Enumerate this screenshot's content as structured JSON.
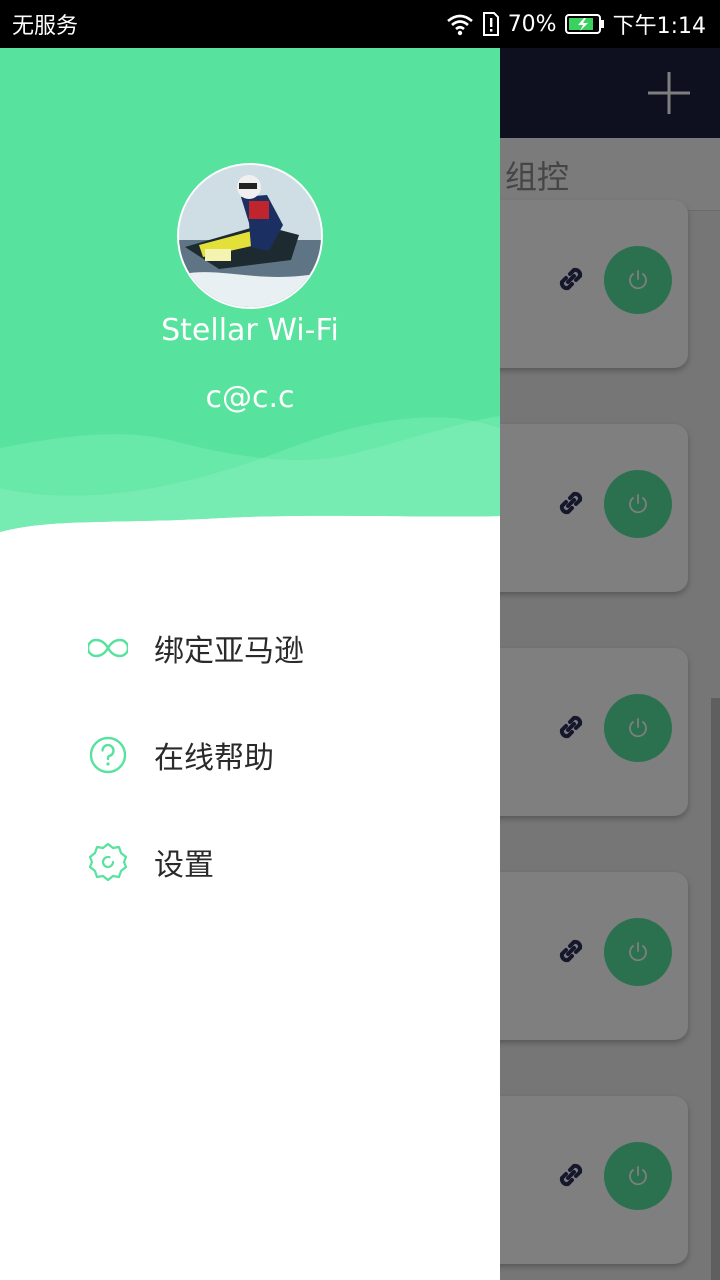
{
  "status_bar": {
    "carrier": "无服务",
    "battery": "70%",
    "time": "下午1:14",
    "icons": [
      "wifi-icon",
      "sim-alert-icon",
      "battery-charging-icon"
    ]
  },
  "background_app": {
    "toolbar_icon": "add-icon",
    "tab_label": "组控",
    "device_cards": [
      {
        "link_icon": "link-icon",
        "power_icon": "power-icon"
      },
      {
        "link_icon": "link-icon",
        "power_icon": "power-icon"
      },
      {
        "link_icon": "link-icon",
        "power_icon": "power-icon"
      },
      {
        "link_icon": "link-icon",
        "power_icon": "power-icon"
      },
      {
        "link_icon": "link-icon",
        "power_icon": "power-icon"
      }
    ]
  },
  "drawer": {
    "user_name": "Stellar Wi-Fi",
    "user_email": "c@c.c",
    "menu": [
      {
        "label": "绑定亚马逊",
        "icon": "infinity-icon"
      },
      {
        "label": "在线帮助",
        "icon": "help-circle-icon"
      },
      {
        "label": "设置",
        "icon": "gear-icon"
      }
    ]
  },
  "colors": {
    "drawer_green": "#57e29e",
    "toolbar_navy": "#1c2140",
    "power_green": "#57e29e",
    "link_navy": "#2b2f5a"
  }
}
